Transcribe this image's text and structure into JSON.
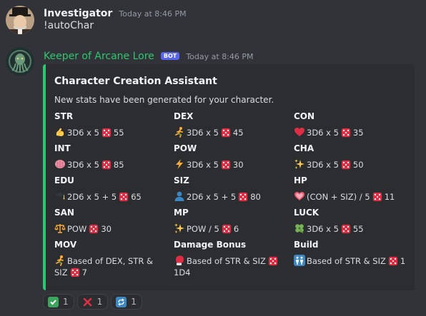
{
  "messages": [
    {
      "username": "Investigator",
      "username_color": "#f2f3f5",
      "timestamp": "Today at 8:46 PM",
      "content": "!autoChar"
    },
    {
      "username": "Keeper of Arcane Lore",
      "username_color": "#2dc770",
      "bot_tag": "BOT",
      "timestamp": "Today at 8:46 PM"
    }
  ],
  "embed": {
    "accent_color": "#2dc770",
    "title": "Character Creation Assistant",
    "description": "New stats have been generated for your character.",
    "fields": [
      {
        "name": "STR",
        "icon": "flexed-biceps-icon",
        "value": "3D6 x 5",
        "result": "55"
      },
      {
        "name": "DEX",
        "icon": "running-person-icon",
        "value": "3D6 x 5",
        "result": "45"
      },
      {
        "name": "CON",
        "icon": "red-heart-icon",
        "value": "3D6 x 5",
        "result": "35"
      },
      {
        "name": "INT",
        "icon": "brain-icon",
        "value": "3D6 x 5",
        "result": "85"
      },
      {
        "name": "POW",
        "icon": "lightning-icon",
        "value": "3D6 x 5",
        "result": "30"
      },
      {
        "name": "CHA",
        "icon": "sparkles-icon",
        "value": "3D6 x 5",
        "result": "50"
      },
      {
        "name": "EDU",
        "icon": "graduation-cap-icon",
        "value": "2D6 x 5 + 5",
        "result": "65"
      },
      {
        "name": "SIZ",
        "icon": "person-silhouette-icon",
        "value": "2D6 x 5 + 5",
        "result": "80"
      },
      {
        "name": "HP",
        "icon": "pink-heart-icon",
        "value": "(CON + SIZ) / 5",
        "result": "11"
      },
      {
        "name": "SAN",
        "icon": "balance-scale-icon",
        "value": "POW",
        "result": "30"
      },
      {
        "name": "MP",
        "icon": "sparkles-icon",
        "value": "POW / 5",
        "result": "6"
      },
      {
        "name": "LUCK",
        "icon": "four-leaf-clover-icon",
        "value": "3D6 x 5",
        "result": "55"
      },
      {
        "name": "MOV",
        "icon": "running-person-icon",
        "value": "Based of DEX, STR & SIZ",
        "result": "7"
      },
      {
        "name": "Damage Bonus",
        "icon": "boxing-glove-icon",
        "value": "Based of STR & SIZ",
        "result": "1D4"
      },
      {
        "name": "Build",
        "icon": "people-icon",
        "value": "Based of STR & SIZ",
        "result": "1"
      }
    ]
  },
  "reactions": [
    {
      "icon": "check-mark-icon",
      "color": "#3ba55c",
      "count": "1"
    },
    {
      "icon": "cross-mark-icon",
      "color": "#dd2e44",
      "count": "1"
    },
    {
      "icon": "repeat-icon",
      "color": "#3b88c3",
      "count": "1"
    }
  ]
}
